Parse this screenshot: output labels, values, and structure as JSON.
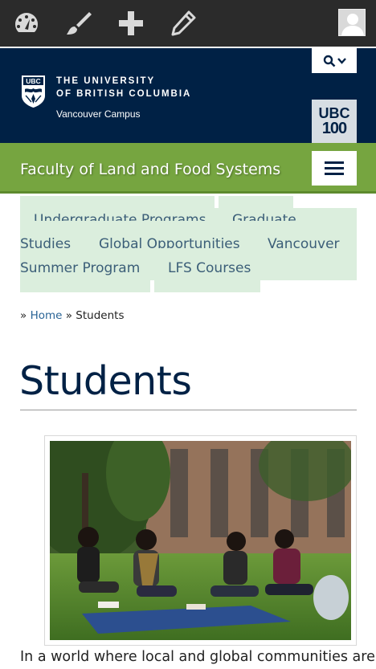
{
  "admin_bar": {
    "icons": [
      "dashboard-icon",
      "paintbrush-icon",
      "plus-icon",
      "pencil-icon"
    ],
    "avatar": "user-avatar"
  },
  "header": {
    "university_line1": "THE UNIVERSITY",
    "university_line2": "OF BRITISH COLUMBIA",
    "campus": "Vancouver Campus",
    "crest_text": "UBC",
    "badge_line1": "UBC",
    "badge_line2": "100"
  },
  "faculty": {
    "title": "Faculty of Land and Food Systems"
  },
  "nav": {
    "links": [
      "Undergraduate Programs",
      "Graduate Studies",
      "Global Opportunities",
      "Vancouver Summer Program",
      "LFS Courses"
    ],
    "undergrad": "Undergraduate Programs",
    "graduate_a": "Graduate",
    "graduate_b": "Studies",
    "global": "Global Opportunities",
    "vancouver_a": "Vancouver",
    "vancouver_b": "Summer Program",
    "courses": "LFS Courses"
  },
  "breadcrumb": {
    "separator": "»",
    "home": "Home",
    "current": "Students"
  },
  "page": {
    "title": "Students",
    "intro": "In a world where local and global communities are"
  },
  "colors": {
    "admin_bar": "#2b2b2b",
    "ubc_blue": "#002145",
    "faculty_green": "#76a540",
    "nav_block": "#dbeedd",
    "link": "#2a6496"
  }
}
